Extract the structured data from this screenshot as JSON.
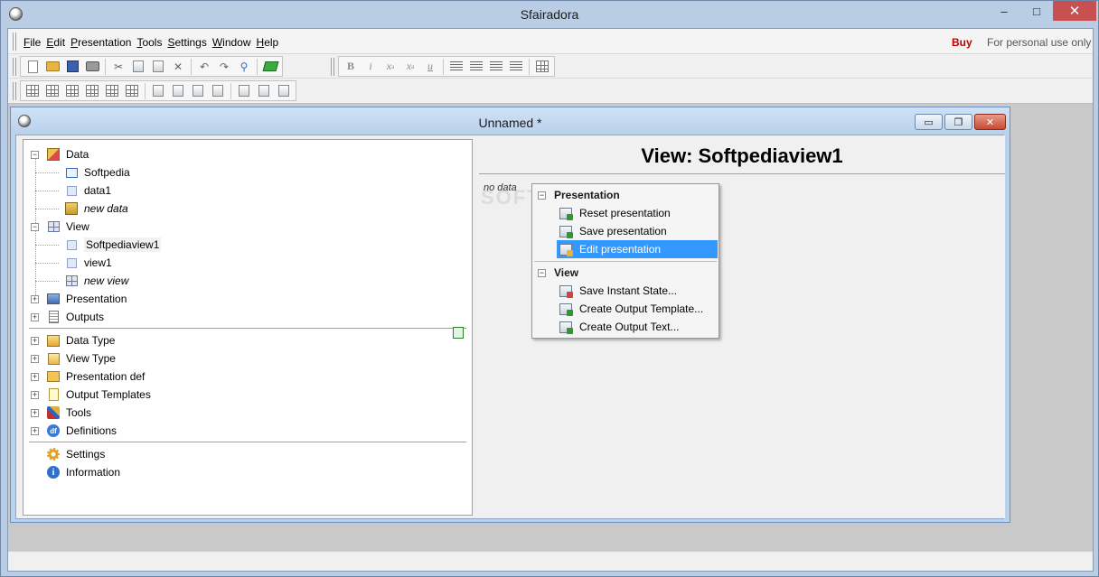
{
  "app": {
    "title": "Sfairadora",
    "controls": {
      "minimize": "–",
      "maximize": "□",
      "close": "✕"
    }
  },
  "menubar": {
    "items": [
      {
        "label": "File",
        "accel": "F",
        "rest": "ile"
      },
      {
        "label": "Edit",
        "accel": "E",
        "rest": "dit"
      },
      {
        "label": "Presentation",
        "accel": "P",
        "rest": "resentation"
      },
      {
        "label": "Tools",
        "accel": "T",
        "rest": "ools"
      },
      {
        "label": "Settings",
        "accel": "S",
        "rest": "ettings"
      },
      {
        "label": "Window",
        "accel": "W",
        "rest": "indow"
      },
      {
        "label": "Help",
        "accel": "H",
        "rest": "elp"
      }
    ],
    "buy": "Buy",
    "license_note": "For personal use only"
  },
  "toolbar": {
    "format": {
      "bold": "B",
      "italic": "i",
      "superscript": "x",
      "subscript": "x",
      "underline": "u"
    }
  },
  "child_window": {
    "title": "Unnamed *",
    "controls": {
      "minimize": "▭",
      "restore": "❐",
      "close": "✕"
    }
  },
  "tree": {
    "data": {
      "label": "Data",
      "expander": "−"
    },
    "data_children": [
      "Softpedia",
      "data1",
      "new data"
    ],
    "view": {
      "label": "View",
      "expander": "−"
    },
    "view_children": [
      "Softpediaview1",
      "view1",
      "new view"
    ],
    "presentation": {
      "label": "Presentation",
      "expander": "+"
    },
    "outputs": {
      "label": "Outputs",
      "expander": "+"
    },
    "data_type": {
      "label": "Data Type",
      "expander": "+"
    },
    "view_type": {
      "label": "View Type",
      "expander": "+"
    },
    "presentation_def": {
      "label": "Presentation def",
      "expander": "+"
    },
    "output_templates": {
      "label": "Output Templates",
      "expander": "+"
    },
    "tools": {
      "label": "Tools",
      "expander": "+"
    },
    "definitions": {
      "label": "Definitions",
      "expander": "+",
      "icon_text": "df"
    },
    "settings": {
      "label": "Settings"
    },
    "information": {
      "label": "Information",
      "icon_text": "i"
    }
  },
  "view_pane": {
    "heading": "View: Softpediaview1",
    "no_data": "no data",
    "watermark": "SOFTPEDIA"
  },
  "context_menu": {
    "presentation_header": "Presentation",
    "presentation_items": [
      "Reset presentation",
      "Save presentation",
      "Edit presentation"
    ],
    "view_header": "View",
    "view_items": [
      "Save Instant State...",
      "Create Output Template...",
      "Create Output Text..."
    ],
    "active_item": "Edit presentation",
    "expander": "−"
  }
}
